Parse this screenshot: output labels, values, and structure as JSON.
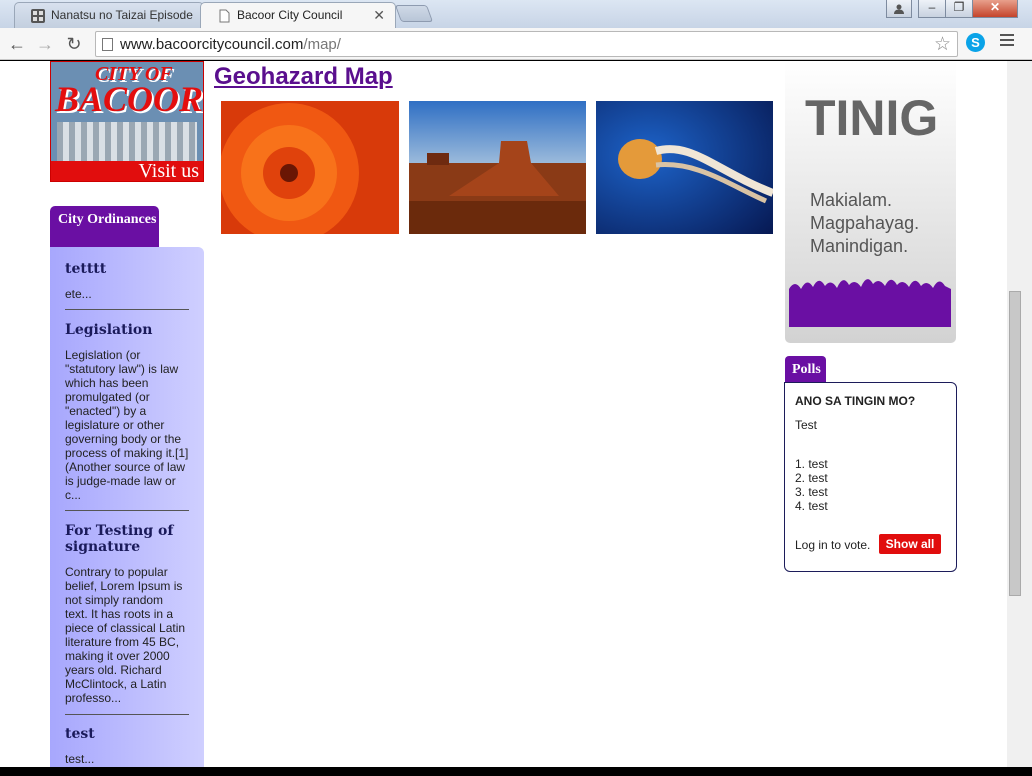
{
  "tabs": [
    {
      "title": "Nanatsu no Taizai Episode"
    },
    {
      "title": "Bacoor City Council"
    }
  ],
  "address": {
    "host": "www.bacoorcitycouncil.com",
    "path": "/map/"
  },
  "logo": {
    "top": "CITY OF",
    "main": "BACOOR",
    "visit": "Visit us"
  },
  "sidebar": {
    "tab_label": "City Ordinances",
    "items": [
      {
        "title": "tetttt",
        "excerpt": "ete..."
      },
      {
        "title": "Legislation",
        "excerpt": "Legislation (or \"statutory law\") is law which has been promulgated (or \"enacted\") by a legislature or other governing body or the process of making it.[1] (Another source of law is judge-made law or c..."
      },
      {
        "title": "For Testing of signature",
        "excerpt": "Contrary to popular belief, Lorem Ipsum is not simply random text. It has roots in a piece of classical Latin literature from 45 BC, making it over 2000 years old. Richard McClintock, a Latin professo..."
      },
      {
        "title": "test",
        "excerpt": "test..."
      }
    ]
  },
  "main": {
    "title": "Geohazard Map"
  },
  "ad": {
    "title": "TINIG",
    "lines": [
      "Makialam.",
      "Magpahayag.",
      "Manindigan."
    ]
  },
  "poll": {
    "tab_label": "Polls",
    "question": "ANO SA TINGIN MO?",
    "description": "Test",
    "options": [
      "1. test",
      "2. test",
      "3. test",
      "4. test"
    ],
    "login_text": "Log in to vote.",
    "show_all": "Show all"
  }
}
